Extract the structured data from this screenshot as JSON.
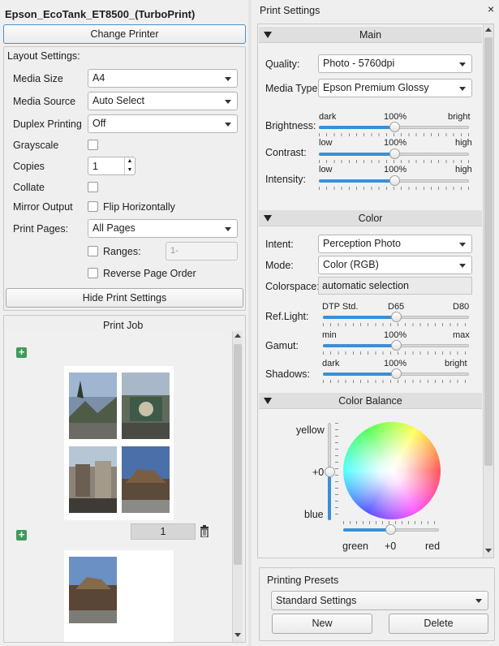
{
  "left": {
    "printer_name": "Epson_EcoTank_ET8500_(TurboPrint)",
    "change_printer": "Change Printer",
    "layout_header": "Layout Settings:",
    "media_size_label": "Media Size",
    "media_size_value": "A4",
    "media_source_label": "Media Source",
    "media_source_value": "Auto Select",
    "duplex_label": "Duplex Printing",
    "duplex_value": "Off",
    "grayscale_label": "Grayscale",
    "copies_label": "Copies",
    "copies_value": "1",
    "collate_label": "Collate",
    "mirror_label": "Mirror Output",
    "flip_label": "Flip Horizontally",
    "print_pages_label": "Print Pages:",
    "print_pages_value": "All Pages",
    "ranges_label": "Ranges:",
    "ranges_placeholder": "1-",
    "reverse_label": "Reverse Page Order",
    "hide_button": "Hide Print Settings",
    "job_title": "Print Job",
    "page1_copies": "1"
  },
  "right": {
    "title": "Print Settings",
    "close": "×",
    "main_section": "Main",
    "quality_label": "Quality:",
    "quality_value": "Photo - 5760dpi",
    "media_type_label": "Media Type:",
    "media_type_value": "Epson Premium Glossy",
    "brightness_label": "Brightness:",
    "brightness_min": "dark",
    "brightness_mid": "100%",
    "brightness_max": "bright",
    "brightness_level": 0.5,
    "contrast_label": "Contrast:",
    "contrast_min": "low",
    "contrast_mid": "100%",
    "contrast_max": "high",
    "contrast_level": 0.5,
    "intensity_label": "Intensity:",
    "intensity_min": "low",
    "intensity_mid": "100%",
    "intensity_max": "high",
    "intensity_level": 0.5,
    "color_section": "Color",
    "intent_label": "Intent:",
    "intent_value": "Perception Photo",
    "mode_label": "Mode:",
    "mode_value": "Color (RGB)",
    "colorspace_label": "Colorspace:",
    "colorspace_value": "automatic selection",
    "reflight_label": "Ref.Light:",
    "reflight_min": "DTP Std.",
    "reflight_mid": "D65",
    "reflight_max": "D80",
    "reflight_level": 0.5,
    "gamut_label": "Gamut:",
    "gamut_min": "min",
    "gamut_mid": "100%",
    "gamut_max": "max",
    "gamut_level": 0.5,
    "shadows_label": "Shadows:",
    "shadows_min": "dark",
    "shadows_mid": "100%",
    "shadows_max": "bright",
    "shadows_level": 0.5,
    "balance_section": "Color Balance",
    "yellow_label": "yellow",
    "zero_label": "+0",
    "blue_label": "blue",
    "green_label": "green",
    "zero_label2": "+0",
    "red_label": "red",
    "presets_title": "Printing Presets",
    "presets_value": "Standard Settings",
    "new_button": "New",
    "delete_button": "Delete"
  },
  "colors": {
    "accent": "#3a8fd8",
    "add_icon": "#3d9b5a"
  }
}
